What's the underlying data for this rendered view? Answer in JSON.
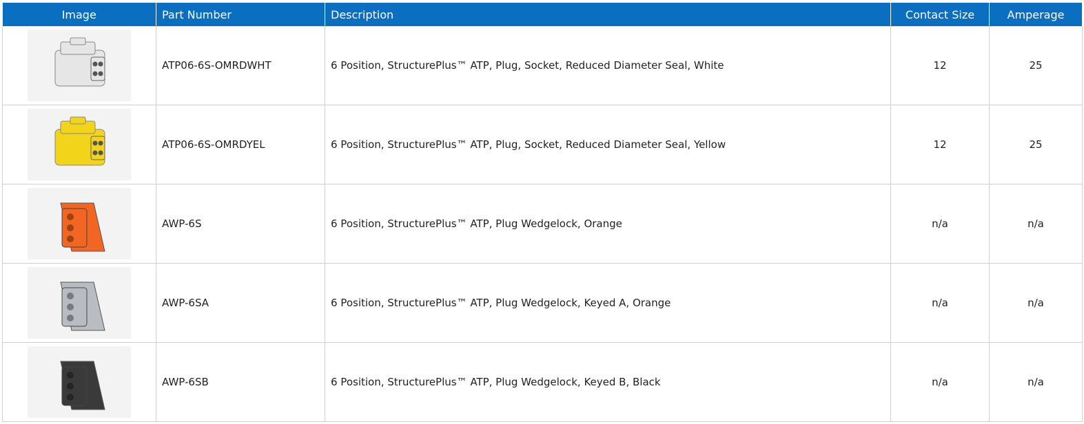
{
  "table": {
    "headers": [
      "Image",
      "Part Number",
      "Description",
      "Contact Size",
      "Amperage"
    ],
    "header_color": "#0b6fc1",
    "rows": [
      {
        "image_icon": "connector-plug-icon",
        "image_color": "#e6e6e6",
        "part_number": "ATP06-6S-OMRDWHT",
        "description": "6 Position, StructurePlus™ ATP, Plug, Socket, Reduced Diameter Seal, White",
        "contact_size": "12",
        "amperage": "25"
      },
      {
        "image_icon": "connector-plug-icon",
        "image_color": "#f2d41a",
        "part_number": "ATP06-6S-OMRDYEL",
        "description": "6 Position, StructurePlus™ ATP, Plug, Socket, Reduced Diameter Seal, Yellow",
        "contact_size": "12",
        "amperage": "25"
      },
      {
        "image_icon": "wedgelock-icon",
        "image_color": "#f26522",
        "part_number": "AWP-6S",
        "description": "6 Position, StructurePlus™ ATP, Plug Wedgelock, Orange",
        "contact_size": "n/a",
        "amperage": "n/a"
      },
      {
        "image_icon": "wedgelock-icon",
        "image_color": "#b9bcc0",
        "part_number": "AWP-6SA",
        "description": "6 Position, StructurePlus™ ATP, Plug Wedgelock, Keyed A, Orange",
        "contact_size": "n/a",
        "amperage": "n/a"
      },
      {
        "image_icon": "wedgelock-icon",
        "image_color": "#3a3a3a",
        "part_number": "AWP-6SB",
        "description": "6 Position, StructurePlus™ ATP, Plug Wedgelock, Keyed B, Black",
        "contact_size": "n/a",
        "amperage": "n/a"
      }
    ]
  }
}
